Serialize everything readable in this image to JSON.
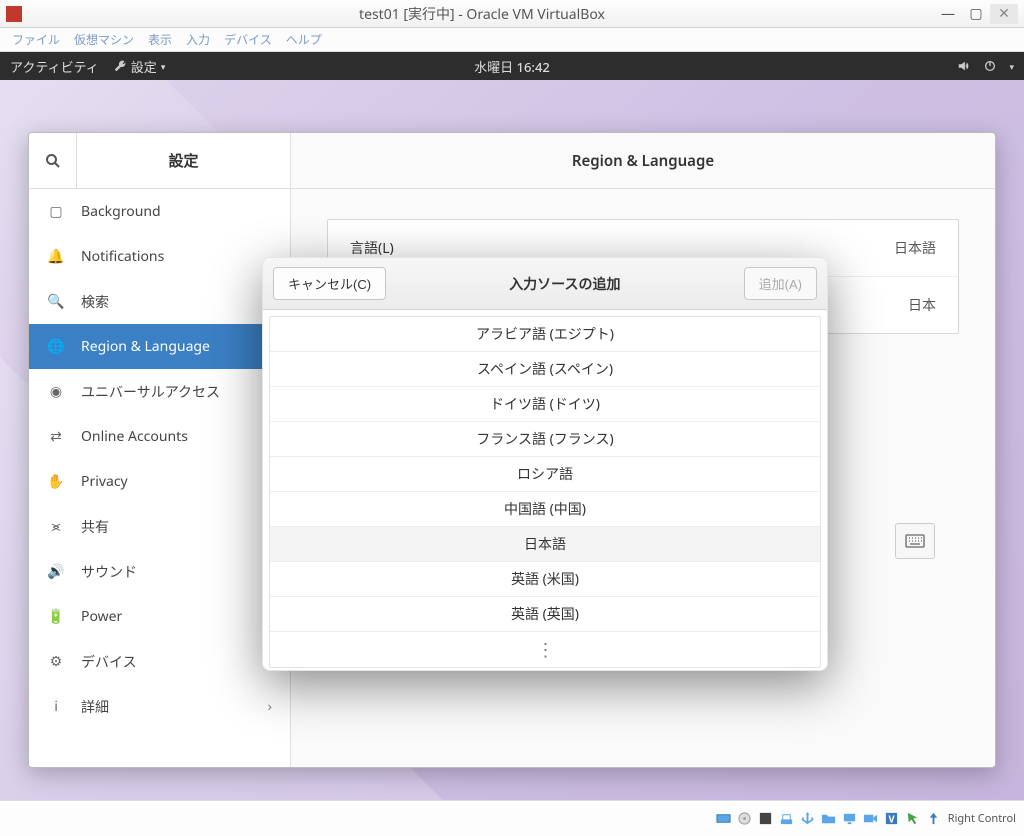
{
  "vbox": {
    "title": "test01 [実行中] - Oracle VM VirtualBox",
    "menu": [
      "ファイル",
      "仮想マシン",
      "表示",
      "入力",
      "デバイス",
      "ヘルプ"
    ],
    "status_text": "Right Control"
  },
  "gnome": {
    "activities": "アクティビティ",
    "app_menu": "設定",
    "clock": "水曜日 16:42"
  },
  "settings": {
    "sidebar_title": "設定",
    "header_title": "Region & Language",
    "items": [
      {
        "label": "Background"
      },
      {
        "label": "Notifications"
      },
      {
        "label": "検索"
      },
      {
        "label": "Region & Language"
      },
      {
        "label": "ユニバーサルアクセス"
      },
      {
        "label": "Online Accounts"
      },
      {
        "label": "Privacy"
      },
      {
        "label": "共有"
      },
      {
        "label": "サウンド"
      },
      {
        "label": "Power"
      },
      {
        "label": "デバイス"
      },
      {
        "label": "詳細"
      }
    ],
    "rows": {
      "language_label": "言語(L)",
      "language_value": "日本語",
      "format_value": "日本"
    }
  },
  "dialog": {
    "cancel": "キャンセル(C)",
    "title": "入力ソースの追加",
    "add": "追加(A)",
    "languages": [
      "アラビア語 (エジプト)",
      "スペイン語 (スペイン)",
      "ドイツ語 (ドイツ)",
      "フランス語 (フランス)",
      "ロシア語",
      "中国語 (中国)",
      "日本語",
      "英語 (米国)",
      "英語 (英国)"
    ],
    "more": "⋮"
  }
}
